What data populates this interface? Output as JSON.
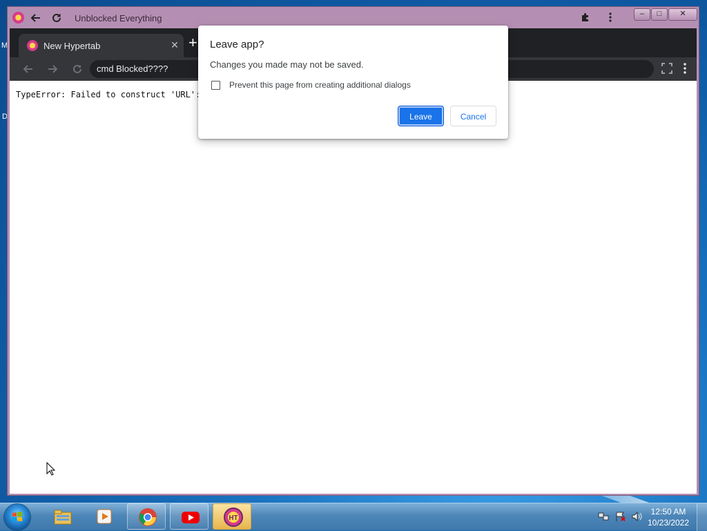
{
  "desktop": {
    "left_letter_1": "M",
    "left_letter_2": "D"
  },
  "window": {
    "title": "Unblocked Everything",
    "minimize": "–",
    "maximize": "□",
    "close": "✕"
  },
  "browser": {
    "tab": {
      "title": "New Hypertab",
      "close": "✕"
    },
    "new_tab": "+",
    "omnibox_text": "cmd Blocked????"
  },
  "content": {
    "error_text": "TypeError: Failed to construct 'URL':"
  },
  "dialog": {
    "title": "Leave app?",
    "message": "Changes you made may not be saved.",
    "checkbox_label": "Prevent this page from creating additional dialogs",
    "leave_label": "Leave",
    "cancel_label": "Cancel"
  },
  "taskbar": {
    "clock_time": "12:50 AM",
    "clock_date": "10/23/2022",
    "pinned": [
      "file-explorer-icon",
      "media-player-icon",
      "chrome-icon",
      "youtube-icon",
      "hypertab-icon"
    ]
  },
  "colors": {
    "window_frame": "#b58fb3",
    "accent_blue": "#1a73e8",
    "tabstrip": "#202124"
  }
}
